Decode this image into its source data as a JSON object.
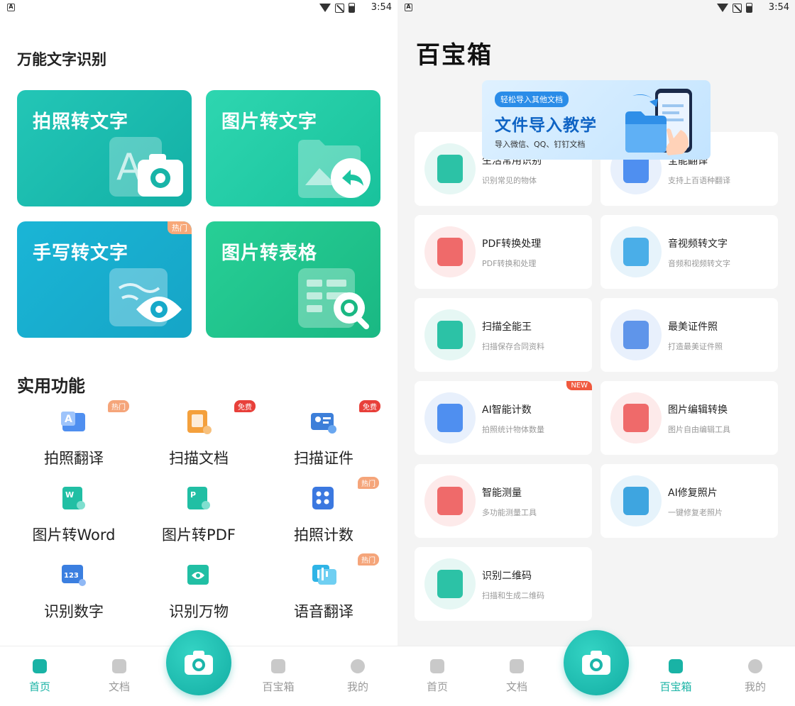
{
  "status_bar": {
    "time": "3:54"
  },
  "home": {
    "ocr_title": "万能文字识别",
    "cards": [
      {
        "label": "拍照转文字"
      },
      {
        "label": "图片转文字"
      },
      {
        "label": "手写转文字",
        "tag": "热门"
      },
      {
        "label": "图片转表格"
      }
    ],
    "utility_title": "实用功能",
    "utilities": [
      {
        "label": "拍照翻译",
        "tag": "热门"
      },
      {
        "label": "扫描文档",
        "tag": "免费"
      },
      {
        "label": "扫描证件",
        "tag": "免费"
      },
      {
        "label": "图片转Word",
        "icon_text": "W"
      },
      {
        "label": "图片转PDF",
        "icon_text": "P"
      },
      {
        "label": "拍照计数",
        "tag": "热门"
      },
      {
        "label": "识别数字",
        "icon_text": "123"
      },
      {
        "label": "识别万物"
      },
      {
        "label": "语音翻译",
        "tag": "热门"
      }
    ]
  },
  "toolbox": {
    "title": "百宝箱",
    "banner": {
      "pill": "轻松导入其他文档",
      "title": "文件导入教学",
      "subtitle": "导入微信、QQ、钉钉文档"
    },
    "tools": [
      {
        "name": "生活常用识别",
        "desc": "识别常见的物体"
      },
      {
        "name": "全能翻译",
        "desc": "支持上百语种翻译"
      },
      {
        "name": "PDF转换处理",
        "desc": "PDF转换和处理"
      },
      {
        "name": "音视频转文字",
        "desc": "音频和视频转文字"
      },
      {
        "name": "扫描全能王",
        "desc": "扫描保存合同资料"
      },
      {
        "name": "最美证件照",
        "desc": "打造最美证件照"
      },
      {
        "name": "AI智能计数",
        "desc": "拍照统计物体数量",
        "tag": "NEW"
      },
      {
        "name": "图片编辑转换",
        "desc": "图片自由编辑工具"
      },
      {
        "name": "智能测量",
        "desc": "多功能测量工具"
      },
      {
        "name": "AI修复照片",
        "desc": "一键修复老照片"
      },
      {
        "name": "识别二维码",
        "desc": "扫描和生成二维码"
      }
    ]
  },
  "nav": {
    "items": [
      {
        "label": "首页",
        "icon": "home-icon"
      },
      {
        "label": "文档",
        "icon": "document-icon"
      },
      {
        "label": "百宝箱",
        "icon": "toolbox-icon"
      },
      {
        "label": "我的",
        "icon": "profile-icon"
      }
    ],
    "camera_icon": "camera-icon",
    "left_active": 0,
    "right_active": 2
  },
  "colors": {
    "accent": "#19b3a5",
    "hot_tag": "#f5a57a",
    "free_tag": "#e8403a",
    "new_tag": "#f0593e",
    "banner_title": "#0e63c4"
  }
}
